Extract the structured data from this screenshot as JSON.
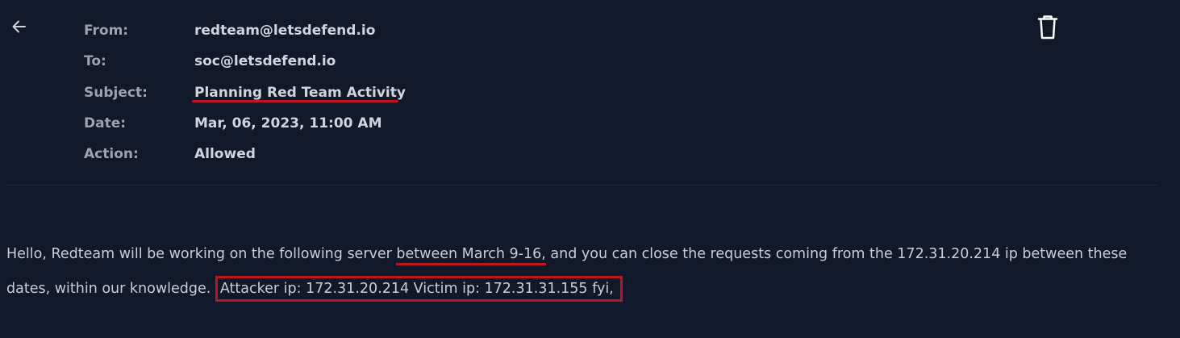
{
  "header": {
    "from_label": "From:",
    "from_value": "redteam@letsdefend.io",
    "to_label": "To:",
    "to_value": "soc@letsdefend.io",
    "subject_label": "Subject:",
    "subject_value": "Planning Red Team Activity",
    "date_label": "Date:",
    "date_value": "Mar, 06, 2023, 11:00 AM",
    "action_label": "Action:",
    "action_value": "Allowed"
  },
  "icons": {
    "back": "arrow-left-icon",
    "delete": "trash-icon"
  },
  "body": {
    "part1": "Hello, Redteam will be working on the following server ",
    "part2": "between March 9-16,",
    "part3": " and you can close the requests coming from the 172.31.20.214 ip between these dates, within our knowledge. ",
    "part4": "Attacker ip: 172.31.20.214 Victim ip: 172.31.31.155 fyi,"
  },
  "colors": {
    "background": "#111827",
    "label": "#9ca3af",
    "value": "#d1d5db",
    "highlight_red": "#c1121f"
  }
}
